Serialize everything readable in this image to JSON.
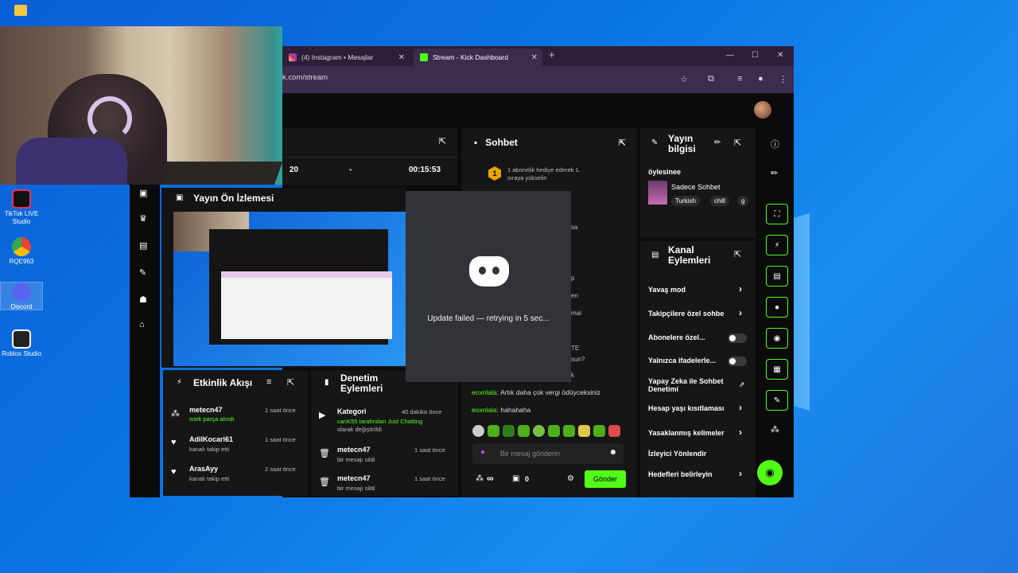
{
  "desktop": {
    "icons": [
      {
        "label": "TikTok LIVE Studio",
        "color": "#111111"
      },
      {
        "label": "RQE963",
        "color": "#e8e8e8"
      },
      {
        "label": "Discord",
        "color": "#5865f2"
      },
      {
        "label": "Roblox Studio",
        "color": "#222222"
      }
    ]
  },
  "browser": {
    "tabs": [
      {
        "label": "(4) Instagram • Mesajlar",
        "icon": "instagram-icon"
      },
      {
        "label": "Stream - Kick Dashboard",
        "icon": "kick-icon"
      }
    ],
    "url": "k.com/stream",
    "new_tab": "+",
    "win_min": "—",
    "win_max": "☐",
    "win_close": "✕"
  },
  "stats": {
    "viewers": "20",
    "dash": "-",
    "uptime": "00:15:53"
  },
  "preview": {
    "title": "Yayın Ön İzlemesi"
  },
  "activity_feed": {
    "title": "Etkinlik Akışı",
    "items": [
      {
        "user": "metecn47",
        "action": "istek parça alındı",
        "time": "1 saat önce",
        "icon": "sub-icon"
      },
      {
        "user": "AdilKocari61",
        "action": "kanalı takip etti",
        "time": "1 saat önce",
        "icon": "heart-icon"
      },
      {
        "user": "ArasAyy",
        "action": "kanalı takip etti",
        "time": "2 saat önce",
        "icon": "heart-icon"
      }
    ]
  },
  "moderation": {
    "title_line1": "Denetim",
    "title_line2": "Eylemleri",
    "items": [
      {
        "user": "Kategori",
        "time": "40 dakika önce",
        "detail_green": "canK55 tarafından Just Chatting",
        "detail": "olarak değiştirildi"
      },
      {
        "user": "metecn47",
        "time": "1 saat önce",
        "detail": "bir mesajı sildi"
      },
      {
        "user": "metecn47",
        "time": "1 saat önce",
        "detail": "bir mesajı sildi"
      }
    ]
  },
  "chat": {
    "title": "Sohbet",
    "pinned_badge": "1",
    "pinned_line1": "1 abonelik hediye ederek 1.",
    "pinned_line2": "sıraya yükselin",
    "fragments": [
      "sa",
      "p",
      "en",
      "mal",
      "TE",
      "sun?",
      "k"
    ],
    "messages": [
      {
        "user": "eoxnlala:",
        "text": "Artık daha çok vergi ödüyceksiniz"
      },
      {
        "user": "eoxnlala:",
        "text": "hahahaha"
      }
    ],
    "input_placeholder": "Bir mesaj gönderin",
    "infinity": "∞",
    "count": "0",
    "send_label": "Gönder"
  },
  "discord": {
    "message": "Update failed — retrying in 5 sec..."
  },
  "stream_info": {
    "title_line1": "Yayın",
    "title_line2": "bilgisi",
    "stream_title": "öylesinee",
    "category": "Sadece Sohbet",
    "tags": [
      "Turkish",
      "chill",
      "g"
    ]
  },
  "channel_actions": {
    "title_line1": "Kanal",
    "title_line2": "Eylemleri",
    "rows": [
      {
        "label": "Yavaş mod",
        "control": "chevron"
      },
      {
        "label": "Takipçilere özel sohbe",
        "control": "chevron"
      },
      {
        "label": "Abonelere özel...",
        "control": "toggle"
      },
      {
        "label": "Yalnızca ifadelerle...",
        "control": "toggle"
      },
      {
        "label": "Yapay Zeka ile Sohbet Denetimi",
        "control": "external"
      },
      {
        "label": "Hesap yaşı kısıtlaması",
        "control": "chevron"
      },
      {
        "label": "Yasaklanmış kelimeler",
        "control": "chevron"
      },
      {
        "label": "İzleyici Yönlendir",
        "control": "none"
      },
      {
        "label": "Hedefleri belirleyin",
        "control": "chevron"
      }
    ]
  },
  "colors": {
    "accent": "#53fc18",
    "panel": "#161616",
    "bg": "#0b0b0b"
  }
}
